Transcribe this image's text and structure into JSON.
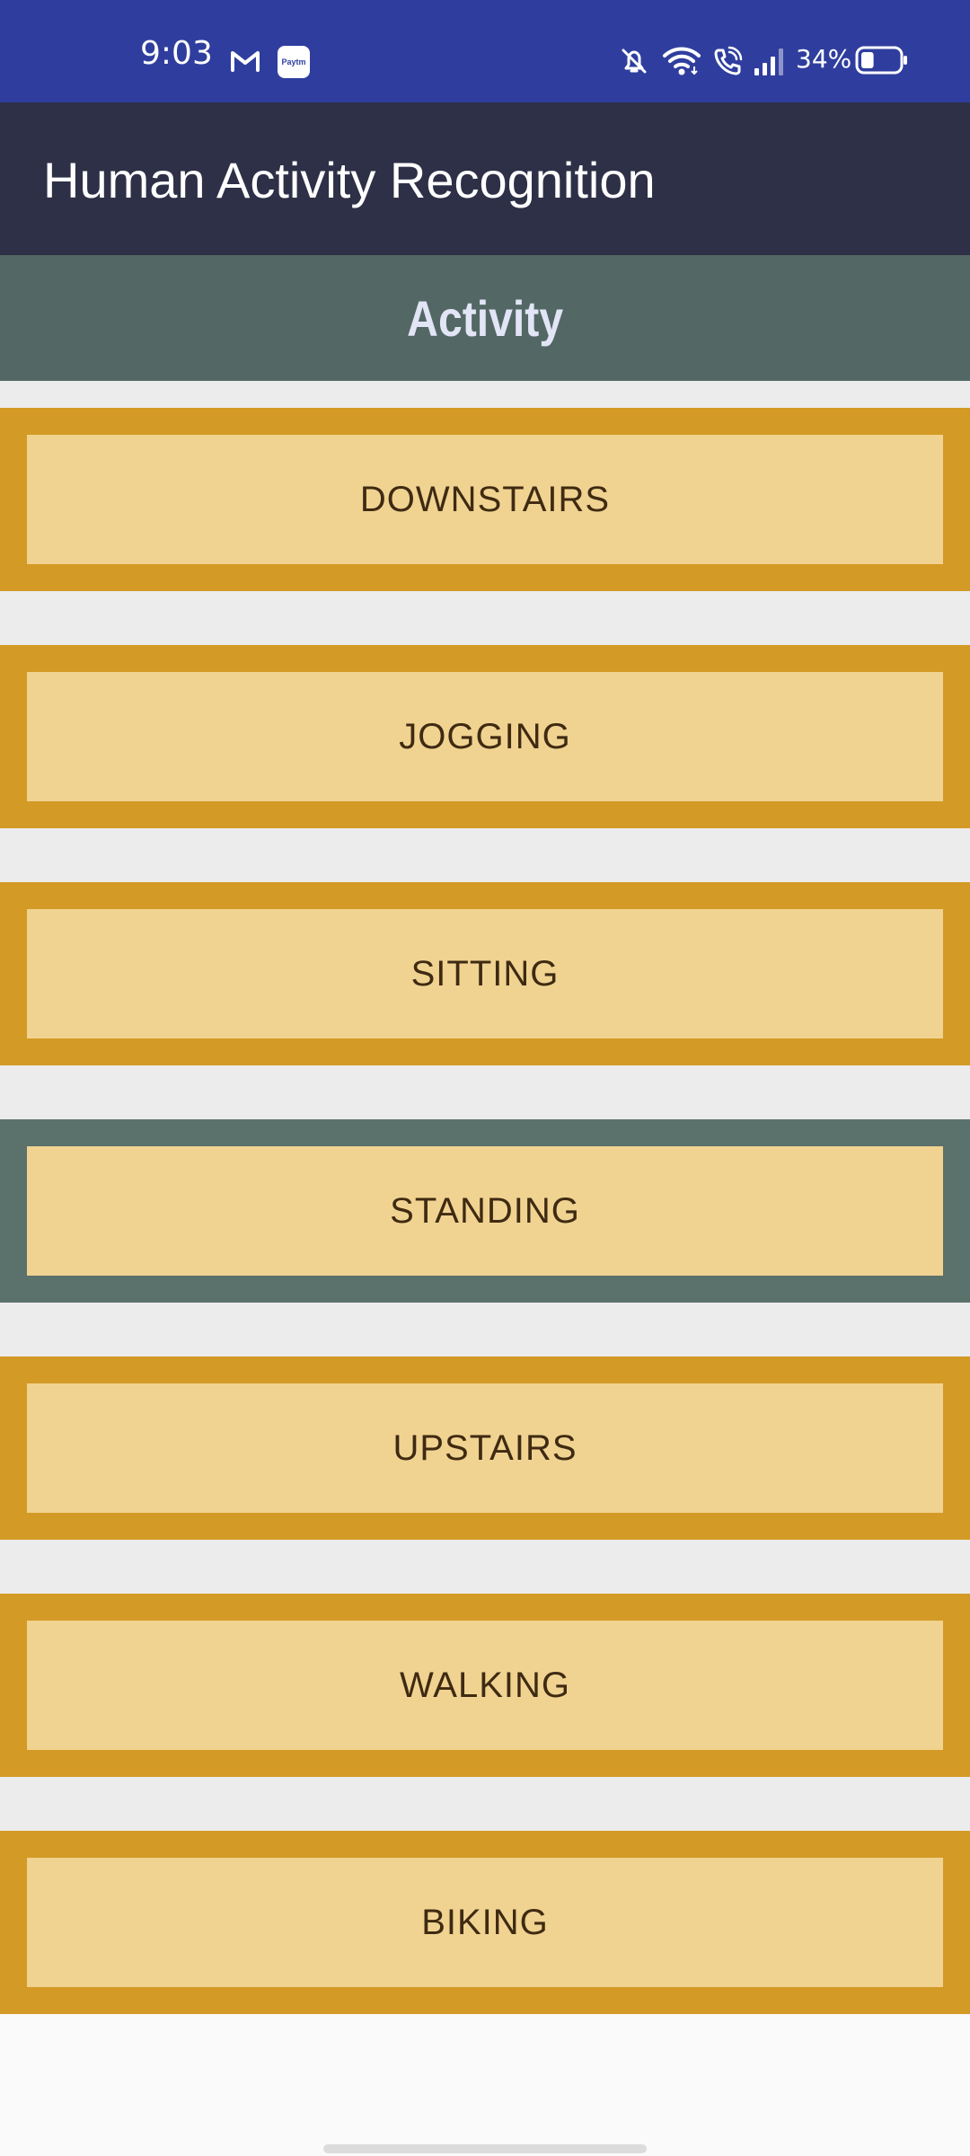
{
  "status_bar": {
    "time": "9:03",
    "paytm_label": "Paytm",
    "battery_percent": "34%",
    "battery_level": 0.34,
    "icons": [
      "gmail-icon",
      "paytm-icon",
      "mute-icon",
      "wifi-icon",
      "wifi-calling-icon",
      "signal-icon",
      "battery-icon"
    ]
  },
  "app_bar": {
    "title": "Human Activity Recognition"
  },
  "section": {
    "title": "Activity"
  },
  "activities": [
    {
      "label": "DOWNSTAIRS",
      "selected": false
    },
    {
      "label": "JOGGING",
      "selected": false
    },
    {
      "label": "SITTING",
      "selected": false
    },
    {
      "label": "STANDING",
      "selected": true
    },
    {
      "label": "UPSTAIRS",
      "selected": false
    },
    {
      "label": "WALKING",
      "selected": false
    },
    {
      "label": "BIKING",
      "selected": false
    }
  ],
  "colors": {
    "status_bar": "#2f3e9e",
    "app_bar": "#2e3047",
    "header": "#536864",
    "card_border": "#d39a25",
    "card_border_selected": "#5b716c",
    "button_fill": "#f0d391",
    "button_text": "#3f2a12",
    "content_background": "#ececec"
  }
}
